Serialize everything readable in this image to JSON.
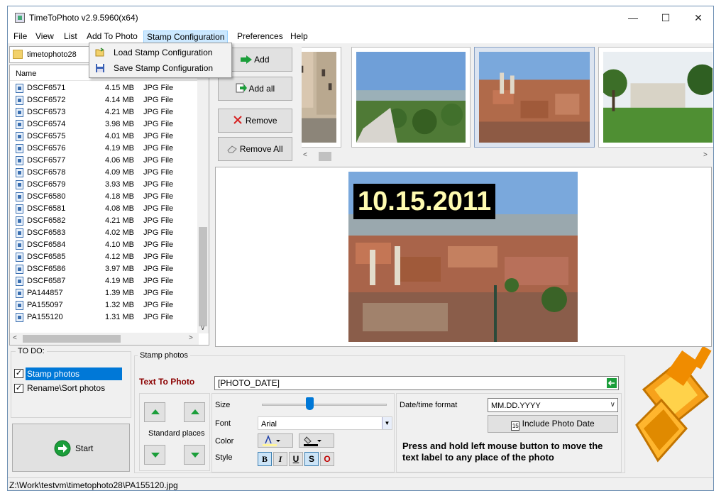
{
  "window": {
    "title": "TimeToPhoto v2.9.5960(x64)"
  },
  "menu": [
    "File",
    "View",
    "List",
    "Add To Photo",
    "Stamp Configuration",
    "Preferences",
    "Help"
  ],
  "stamp_menu": {
    "items": [
      "Load Stamp Configuration",
      "Save Stamp Configuration"
    ]
  },
  "folder": {
    "name": "timetophoto28"
  },
  "file_list": {
    "header": "Name",
    "files": [
      {
        "name": "DSCF6571",
        "size": "4.15 MB",
        "type": "JPG File"
      },
      {
        "name": "DSCF6572",
        "size": "4.14 MB",
        "type": "JPG File"
      },
      {
        "name": "DSCF6573",
        "size": "4.21 MB",
        "type": "JPG File"
      },
      {
        "name": "DSCF6574",
        "size": "3.98 MB",
        "type": "JPG File"
      },
      {
        "name": "DSCF6575",
        "size": "4.01 MB",
        "type": "JPG File"
      },
      {
        "name": "DSCF6576",
        "size": "4.19 MB",
        "type": "JPG File"
      },
      {
        "name": "DSCF6577",
        "size": "4.06 MB",
        "type": "JPG File"
      },
      {
        "name": "DSCF6578",
        "size": "4.09 MB",
        "type": "JPG File"
      },
      {
        "name": "DSCF6579",
        "size": "3.93 MB",
        "type": "JPG File"
      },
      {
        "name": "DSCF6580",
        "size": "4.18 MB",
        "type": "JPG File"
      },
      {
        "name": "DSCF6581",
        "size": "4.08 MB",
        "type": "JPG File"
      },
      {
        "name": "DSCF6582",
        "size": "4.21 MB",
        "type": "JPG File"
      },
      {
        "name": "DSCF6583",
        "size": "4.02 MB",
        "type": "JPG File"
      },
      {
        "name": "DSCF6584",
        "size": "4.10 MB",
        "type": "JPG File"
      },
      {
        "name": "DSCF6585",
        "size": "4.12 MB",
        "type": "JPG File"
      },
      {
        "name": "DSCF6586",
        "size": "3.97 MB",
        "type": "JPG File"
      },
      {
        "name": "DSCF6587",
        "size": "4.19 MB",
        "type": "JPG File"
      },
      {
        "name": "PA144857",
        "size": "1.39 MB",
        "type": "JPG File"
      },
      {
        "name": "PA155097",
        "size": "1.32 MB",
        "type": "JPG File"
      },
      {
        "name": "PA155120",
        "size": "1.31 MB",
        "type": "JPG File"
      }
    ]
  },
  "actions": {
    "add": "Add",
    "add_all": "Add all",
    "remove": "Remove",
    "remove_all": "Remove All"
  },
  "preview": {
    "stamp_text": "10.15.2011"
  },
  "todo": {
    "title": "TO DO:",
    "stamp_photos": "Stamp photos",
    "rename_sort": "Rename\\Sort photos",
    "start": "Start"
  },
  "stamp": {
    "group_title": "Stamp photos",
    "text_to_photo_label": "Text To Photo",
    "text_value": "[PHOTO_DATE]",
    "standard_places": "Standard places",
    "size_label": "Size",
    "font_label": "Font",
    "font_value": "Arial",
    "color_label": "Color",
    "style_label": "Style",
    "style_buttons": [
      "B",
      "I",
      "U",
      "S",
      "O"
    ],
    "date_format_label": "Date/time format",
    "date_format_value": "MM.DD.YYYY",
    "include_date_button": "Include Photo Date",
    "include_date_icon": "15",
    "hint": "Press and hold left mouse button to move the text label to any place of the photo"
  },
  "status": {
    "path": "Z:\\Work\\testvm\\timetophoto28\\PA155120.jpg"
  },
  "colors": {
    "accent": "#cce8ff",
    "stamp_text": "#fffbb0",
    "title_red": "#8b0000",
    "arrow_green": "#1b9e3a"
  }
}
